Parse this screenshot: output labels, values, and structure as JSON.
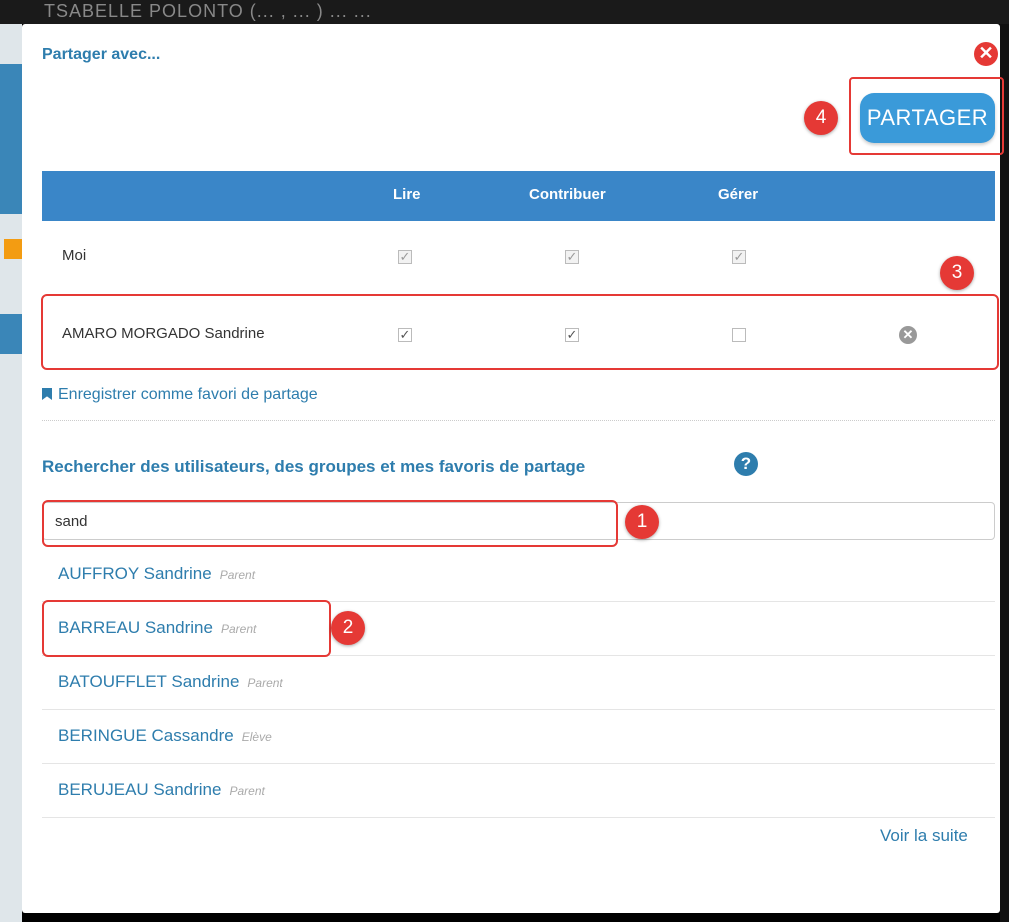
{
  "background": {
    "title": "TSABELLE POLONTO (... , ... ) ... ..."
  },
  "modal": {
    "title": "Partager avec...",
    "close_icon": "close-icon"
  },
  "share_button": {
    "label": "PARTAGER"
  },
  "badges": [
    "1",
    "2",
    "3",
    "4"
  ],
  "table": {
    "headers": [
      "Lire",
      "Contribuer",
      "Gérer"
    ],
    "rows": [
      {
        "name": "Moi",
        "lire": true,
        "contribuer": true,
        "gerer": true,
        "disabled": true
      },
      {
        "name": "AMARO MORGADO Sandrine",
        "lire": true,
        "contribuer": true,
        "gerer": false,
        "disabled": false
      }
    ]
  },
  "favorite_link": "Enregistrer comme favori de partage",
  "search": {
    "title": "Rechercher des utilisateurs, des groupes et mes favoris de partage",
    "value": "sand"
  },
  "results": [
    {
      "name": "AUFFROY Sandrine",
      "role": "Parent"
    },
    {
      "name": "BARREAU Sandrine",
      "role": "Parent"
    },
    {
      "name": "BATOUFFLET Sandrine",
      "role": "Parent"
    },
    {
      "name": "BERINGUE Cassandre",
      "role": "Elève"
    },
    {
      "name": "BERUJEAU Sandrine",
      "role": "Parent"
    }
  ],
  "more_link": "Voir la suite",
  "colors": {
    "accent": "#2e7dad",
    "header": "#3a86c8",
    "highlight": "#e53935",
    "button": "#3a9ad9"
  }
}
